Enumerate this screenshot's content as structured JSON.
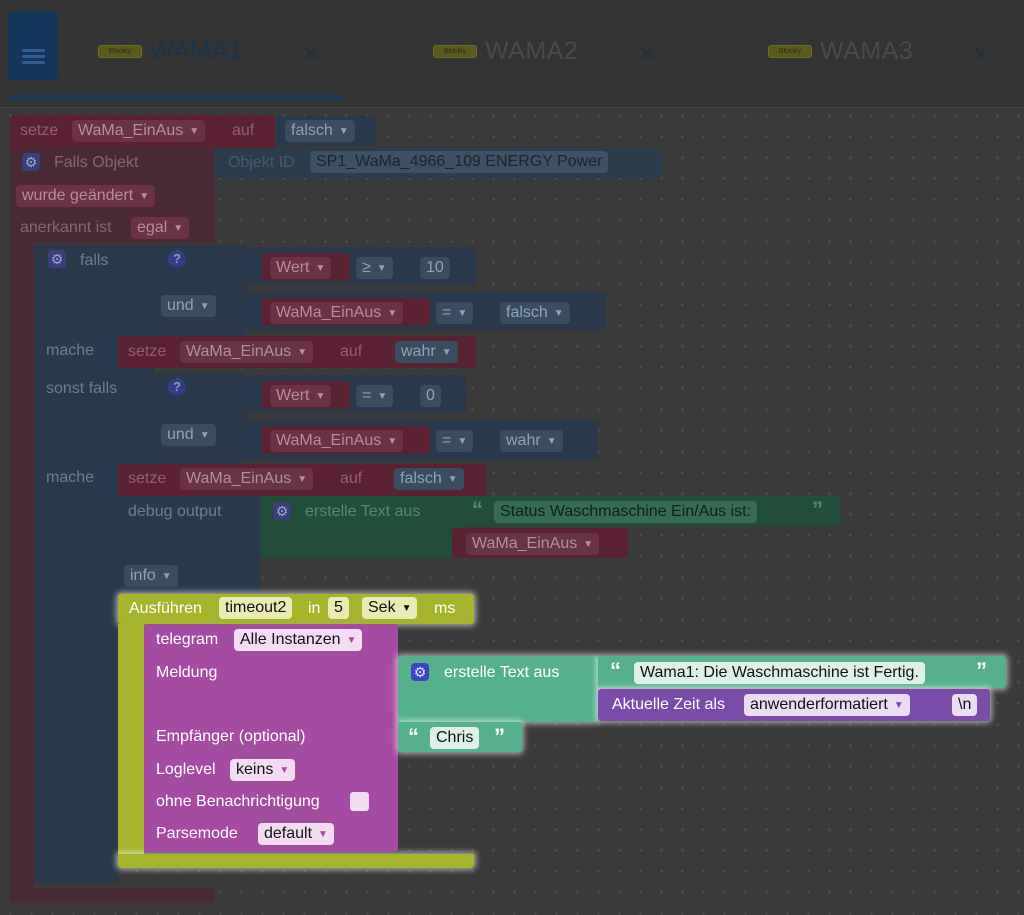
{
  "tabs": [
    {
      "logo": "Blockly",
      "title": "WAMA1",
      "close": "×"
    },
    {
      "logo": "Blockly",
      "title": "WAMA2",
      "close": "×"
    },
    {
      "logo": "Blockly",
      "title": "WAMA3",
      "close": "×"
    }
  ],
  "colors": {
    "variable": "#5b2233",
    "logic": "#2a3a4c",
    "event": "#4a2a37",
    "text": "#214e3a",
    "execute": "#a6b42d",
    "telegram": "#a34ca2",
    "textBright": "#55b08d",
    "time": "#7a4ba9"
  },
  "script": {
    "set1": {
      "label": "setze",
      "var": "WaMa_EinAus",
      "to": "auf",
      "value": "falsch"
    },
    "trigger": {
      "label": "Falls Objekt",
      "objid_label": "Objekt ID",
      "objid_value": "SP1_WaMa_4966_109 ENERGY  Power",
      "changed": "wurde geändert",
      "ack_label": "anerkannt ist",
      "ack_value": "egal"
    },
    "if": {
      "falls": "falls",
      "help": "?",
      "cond1": {
        "left": "Wert",
        "op": "≥",
        "right": "10"
      },
      "and1": "und",
      "cond2": {
        "left": "WaMa_EinAus",
        "op": "=",
        "right": "falsch"
      },
      "mache1": "mache",
      "set2": {
        "label": "setze",
        "var": "WaMa_EinAus",
        "to": "auf",
        "value": "wahr"
      },
      "sonst": "sonst falls",
      "cond3": {
        "left": "Wert",
        "op": "=",
        "right": "0"
      },
      "and2": "und",
      "cond4": {
        "left": "WaMa_EinAus",
        "op": "=",
        "right": "wahr"
      },
      "mache2": "mache",
      "set3": {
        "label": "setze",
        "var": "WaMa_EinAus",
        "to": "auf",
        "value": "falsch"
      },
      "debug": {
        "label": "debug output",
        "create_text": "erstelle Text aus",
        "text": "Status Waschmaschine Ein/Aus ist:",
        "var": "WaMa_EinAus",
        "level": "info"
      }
    },
    "timeout": {
      "label": "Ausführen",
      "name": "timeout2",
      "in": "in",
      "value": "5",
      "unit": "Sek",
      "ms": "ms"
    },
    "telegram": {
      "label": "telegram",
      "instances": "Alle Instanzen",
      "message_label": "Meldung",
      "create_text": "erstelle Text aus",
      "message_text": "Wama1: Die Waschmaschine ist Fertig.",
      "time_label": "Aktuelle Zeit als",
      "time_format": "anwenderformatiert",
      "newline": "\\n",
      "recipient_label": "Empfänger (optional)",
      "recipient": "Chris",
      "loglevel_label": "Loglevel",
      "loglevel": "keins",
      "nonotify_label": "ohne Benachrichtigung",
      "parsemode_label": "Parsemode",
      "parsemode": "default"
    }
  },
  "glyphs": {
    "dropdown": "▼",
    "gear": "⚙",
    "open_quote": "“",
    "close_quote": "”"
  }
}
